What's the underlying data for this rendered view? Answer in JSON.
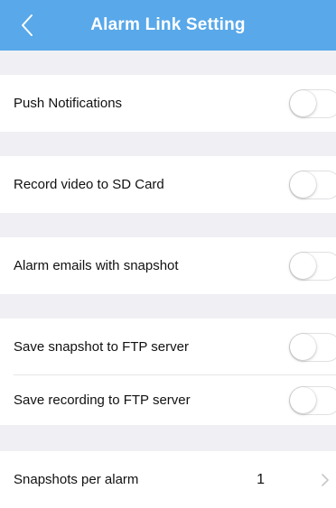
{
  "header": {
    "title": "Alarm Link Setting",
    "back_icon": "chevron-left-icon",
    "background": "#58a8ea"
  },
  "settings": {
    "push_notifications": {
      "label": "Push Notifications",
      "enabled": false
    },
    "record_video_sd": {
      "label": "Record video to SD Card",
      "enabled": false
    },
    "alarm_emails": {
      "label": "Alarm emails with snapshot",
      "enabled": false
    },
    "ftp_snapshot": {
      "label": "Save snapshot to FTP server",
      "enabled": false
    },
    "ftp_recording": {
      "label": "Save recording to FTP server",
      "enabled": false
    },
    "snapshots_per_alarm": {
      "label": "Snapshots per alarm",
      "value": "1"
    }
  }
}
